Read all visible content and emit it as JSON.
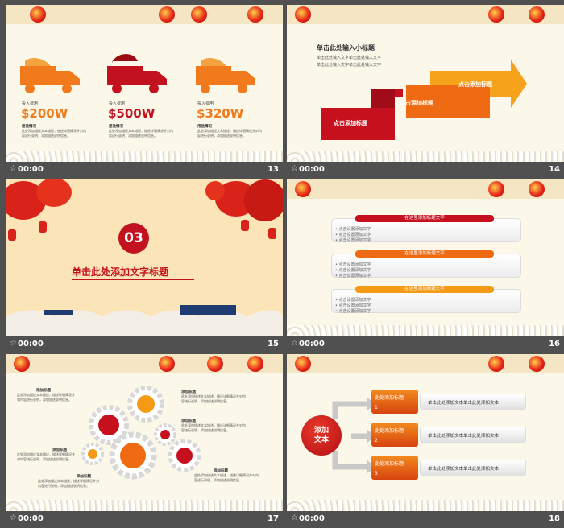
{
  "slides": [
    {
      "number": "13",
      "time": "00:00",
      "items": [
        {
          "label": "投入费用",
          "value": "$200W",
          "title": "用途情况",
          "desc": "此处添加描述文本描述，描述详细情况并对内容进行说明，添加描述说明信息。",
          "color": "#f07a1c"
        },
        {
          "label": "投入费用",
          "value": "$500W",
          "title": "用途情况",
          "desc": "此处添加描述文本描述，描述详细情况并对内容进行说明，添加描述说明信息。",
          "color": "#c3121f"
        },
        {
          "label": "投入费用",
          "value": "$320W",
          "title": "用途情况",
          "desc": "此处添加描述文本描述，描述详细情况并对内容进行说明，添加描述说明信息。",
          "color": "#f07a1c"
        }
      ]
    },
    {
      "number": "14",
      "time": "00:00",
      "subtitle": "单击此处输入小标题",
      "line1": "单击此处输入文字单击此处输入文字",
      "line2": "单击此处输入文字单击此处输入文字",
      "steps": [
        "点击添加标题",
        "点击添加标题",
        "点击添加标题"
      ]
    },
    {
      "number": "15",
      "time": "00:00",
      "badge": "03",
      "heading": "单击此处添加文字标题"
    },
    {
      "number": "16",
      "time": "00:00",
      "groups": [
        {
          "title": "在这里添加标题文字",
          "items": [
            "点击设置添加文字",
            "点击设置添加文字",
            "点击设置添加文字"
          ]
        },
        {
          "title": "在这里添加标题文字",
          "items": [
            "点击设置添加文字",
            "点击设置添加文字",
            "点击设置添加文字"
          ]
        },
        {
          "title": "在这里添加标题文字",
          "items": [
            "点击设置添加文字",
            "点击设置添加文字",
            "点击设置添加文字"
          ]
        }
      ]
    },
    {
      "number": "17",
      "time": "00:00",
      "labels": [
        {
          "title": "添加标题",
          "desc": "此处添加描述文本描述，描述详细情况并对内容进行说明，添加描述说明信息。"
        },
        {
          "title": "添加标题",
          "desc": "此处添加描述文本描述，描述详细情况并对内容进行说明，添加描述说明信息。"
        },
        {
          "title": "添加标题",
          "desc": "此处添加描述文本描述，描述详细情况并对内容进行说明，添加描述说明信息。"
        },
        {
          "title": "添加标题",
          "desc": "此处添加描述文本描述，描述详细情况并对内容进行说明，添加描述说明信息。"
        },
        {
          "title": "添加标题",
          "desc": "此处添加描述文本描述，描述详细情况并对内容进行说明，添加描述说明信息。"
        },
        {
          "title": "添加标题",
          "desc": "此处添加描述文本描述，描述详细情况并对内容进行说明，添加描述说明信息。"
        }
      ]
    },
    {
      "number": "18",
      "time": "00:00",
      "center": "添加\n文本",
      "rows": [
        {
          "title": "此处添加标题",
          "n": "1",
          "text": "单击此处添加文本单击此处添加文本"
        },
        {
          "title": "此处添加标题",
          "n": "2",
          "text": "单击此处添加文本单击此处添加文本"
        },
        {
          "title": "此处添加标题",
          "n": "3",
          "text": "单击此处添加文本单击此处添加文本"
        }
      ]
    }
  ]
}
